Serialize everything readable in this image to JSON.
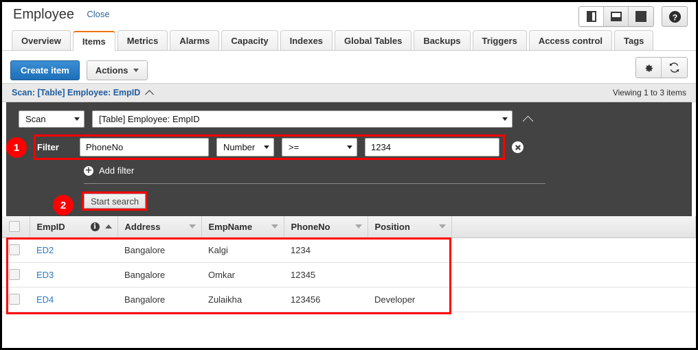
{
  "header": {
    "title": "Employee",
    "close_label": "Close",
    "window_controls": [
      {
        "name": "split-left-view-button",
        "icon": "pane-left-icon",
        "active": true
      },
      {
        "name": "split-bottom-view-button",
        "icon": "pane-bottom-icon",
        "active": false
      },
      {
        "name": "full-view-button",
        "icon": "pane-full-icon",
        "active": false
      }
    ],
    "help_label": "?"
  },
  "tabs": [
    {
      "label": "Overview",
      "active": false
    },
    {
      "label": "Items",
      "active": true
    },
    {
      "label": "Metrics",
      "active": false
    },
    {
      "label": "Alarms",
      "active": false
    },
    {
      "label": "Capacity",
      "active": false
    },
    {
      "label": "Indexes",
      "active": false
    },
    {
      "label": "Global Tables",
      "active": false
    },
    {
      "label": "Backups",
      "active": false
    },
    {
      "label": "Triggers",
      "active": false
    },
    {
      "label": "Access control",
      "active": false
    },
    {
      "label": "Tags",
      "active": false
    }
  ],
  "toolbar": {
    "create_item_label": "Create item",
    "actions_label": "Actions",
    "settings_icon": "gear-icon",
    "refresh_icon": "refresh-icon"
  },
  "scan_bar": {
    "title": "Scan: [Table] Employee: EmpID",
    "viewing": "Viewing 1 to 3 items"
  },
  "query_panel": {
    "operation": "Scan",
    "target": "[Table] Employee: EmpID",
    "filter": {
      "label": "Filter",
      "attribute": "PhoneNo",
      "type": "Number",
      "operator": ">=",
      "value": "1234",
      "remove_icon": "close-circle-icon"
    },
    "add_filter_label": "Add filter",
    "start_search_label": "Start search",
    "annotations": [
      {
        "number": "1",
        "color": "#ff0000"
      },
      {
        "number": "2",
        "color": "#ff0000"
      }
    ]
  },
  "table": {
    "columns": [
      {
        "label": "EmpID",
        "info": true,
        "sort": "asc"
      },
      {
        "label": "Address",
        "info": false,
        "sort": "none"
      },
      {
        "label": "EmpName",
        "info": false,
        "sort": "none"
      },
      {
        "label": "PhoneNo",
        "info": false,
        "sort": "none"
      },
      {
        "label": "Position",
        "info": false,
        "sort": "none"
      }
    ],
    "rows": [
      {
        "EmpID": "ED2",
        "Address": "Bangalore",
        "EmpName": "Kalgi",
        "PhoneNo": "1234",
        "Position": ""
      },
      {
        "EmpID": "ED3",
        "Address": "Bangalore",
        "EmpName": "Omkar",
        "PhoneNo": "12345",
        "Position": ""
      },
      {
        "EmpID": "ED4",
        "Address": "Bangalore",
        "EmpName": "Zulaikha",
        "PhoneNo": "123456",
        "Position": "Developer"
      }
    ]
  },
  "colors": {
    "accent_orange": "#ec7211",
    "link_blue": "#2a7ac0",
    "primary_button": "#1d6fb8",
    "dark_panel": "#434343",
    "annotation_red": "#ff0000"
  }
}
